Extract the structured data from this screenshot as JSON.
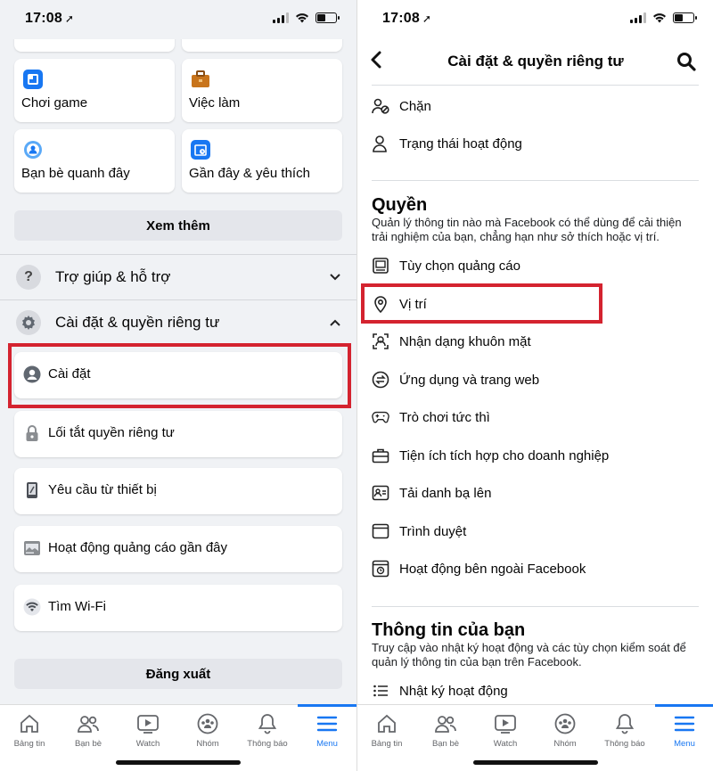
{
  "status": {
    "time": "17:08"
  },
  "left": {
    "tiles": [
      {
        "label": "Chơi game",
        "icon": "game-icon",
        "color": "#1877f2"
      },
      {
        "label": "Việc làm",
        "icon": "briefcase-icon",
        "color": "#c8741b"
      },
      {
        "label": "Bạn bè quanh đây",
        "icon": "nearby-friends-icon",
        "color": "#1877f2"
      },
      {
        "label": "Gần đây & yêu thích",
        "icon": "recent-favorites-icon",
        "color": "#1877f2"
      }
    ],
    "see_more": "Xem thêm",
    "help_section": "Trợ giúp & hỗ trợ",
    "settings_section": "Cài đặt & quyền riêng tư",
    "settings_items": [
      {
        "label": "Cài đặt",
        "icon": "user-gear-icon"
      },
      {
        "label": "Lối tắt quyền riêng tư",
        "icon": "lock-icon"
      },
      {
        "label": "Yêu cầu từ thiết bị",
        "icon": "device-icon"
      },
      {
        "label": "Hoạt động quảng cáo gần đây",
        "icon": "ad-activity-icon"
      },
      {
        "label": "Tìm Wi-Fi",
        "icon": "wifi-icon"
      }
    ],
    "logout": "Đăng xuất",
    "highlight_color": "#d4232f"
  },
  "right": {
    "title": "Cài đặt & quyền riêng tư",
    "top_items": [
      {
        "label": "Chặn",
        "icon": "block-user-icon"
      },
      {
        "label": "Trạng thái hoạt động",
        "icon": "active-status-icon"
      }
    ],
    "permissions": {
      "title": "Quyền",
      "desc": "Quản lý thông tin nào mà Facebook có thể dùng để cải thiện trải nghiệm của bạn, chẳng hạn như sở thích hoặc vị trí.",
      "items": [
        {
          "label": "Tùy chọn quảng cáo",
          "icon": "ad-preferences-icon"
        },
        {
          "label": "Vị trí",
          "icon": "location-pin-icon"
        },
        {
          "label": "Nhận dạng khuôn mặt",
          "icon": "face-recognition-icon"
        },
        {
          "label": "Ứng dụng và trang web",
          "icon": "apps-websites-icon"
        },
        {
          "label": "Trò chơi tức thì",
          "icon": "gamepad-icon"
        },
        {
          "label": "Tiện ích tích hợp cho doanh nghiệp",
          "icon": "business-integration-icon"
        },
        {
          "label": "Tải danh bạ lên",
          "icon": "contacts-upload-icon"
        },
        {
          "label": "Trình duyệt",
          "icon": "browser-icon"
        },
        {
          "label": "Hoạt động bên ngoài Facebook",
          "icon": "off-facebook-activity-icon"
        }
      ]
    },
    "your_info": {
      "title": "Thông tin của bạn",
      "desc": "Truy cập vào nhật ký hoạt động và các tùy chọn kiểm soát để quản lý thông tin của bạn trên Facebook.",
      "items": [
        {
          "label": "Nhật ký hoạt động",
          "icon": "activity-log-icon"
        }
      ]
    }
  },
  "tabbar": [
    {
      "label": "Bảng tin",
      "icon": "home-icon"
    },
    {
      "label": "Bạn bè",
      "icon": "friends-icon"
    },
    {
      "label": "Watch",
      "icon": "watch-icon"
    },
    {
      "label": "Nhóm",
      "icon": "groups-icon"
    },
    {
      "label": "Thông báo",
      "icon": "bell-icon"
    },
    {
      "label": "Menu",
      "icon": "menu-icon",
      "active": true
    }
  ],
  "accent": "#1877f2"
}
